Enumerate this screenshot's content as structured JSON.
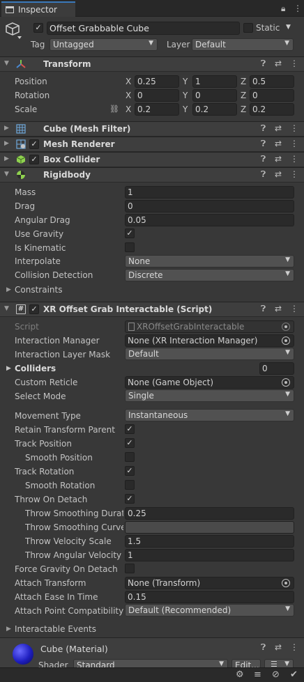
{
  "tab": {
    "label": "Inspector"
  },
  "object": {
    "name": "Offset Grabbable Cube",
    "static_label": "Static",
    "tag_label": "Tag",
    "tag_value": "Untagged",
    "layer_label": "Layer",
    "layer_value": "Default"
  },
  "transform": {
    "title": "Transform",
    "position_label": "Position",
    "rotation_label": "Rotation",
    "scale_label": "Scale",
    "x": "X",
    "y": "Y",
    "z": "Z",
    "position": [
      "0.25",
      "1",
      "0.5"
    ],
    "rotation": [
      "0",
      "0",
      "0"
    ],
    "scale": [
      "0.2",
      "0.2",
      "0.2"
    ]
  },
  "components": {
    "mesh_filter": "Cube (Mesh Filter)",
    "mesh_renderer": "Mesh Renderer",
    "box_collider": "Box Collider",
    "rigidbody": "Rigidbody"
  },
  "rigidbody": {
    "mass_label": "Mass",
    "mass": "1",
    "drag_label": "Drag",
    "drag": "0",
    "angular_drag_label": "Angular Drag",
    "angular_drag": "0.05",
    "use_gravity_label": "Use Gravity",
    "is_kinematic_label": "Is Kinematic",
    "interpolate_label": "Interpolate",
    "interpolate": "None",
    "collision_label": "Collision Detection",
    "collision": "Discrete",
    "constraints_label": "Constraints"
  },
  "xr": {
    "title": "XR Offset Grab Interactable (Script)",
    "script_label": "Script",
    "script": "XROffsetGrabInteractable",
    "interaction_manager_label": "Interaction Manager",
    "interaction_manager": "None (XR Interaction Manager)",
    "layer_mask_label": "Interaction Layer Mask",
    "layer_mask": "Default",
    "colliders_label": "Colliders",
    "colliders": "0",
    "custom_reticle_label": "Custom Reticle",
    "custom_reticle": "None (Game Object)",
    "select_mode_label": "Select Mode",
    "select_mode": "Single",
    "movement_type_label": "Movement Type",
    "movement_type": "Instantaneous",
    "retain_parent_label": "Retain Transform Parent",
    "track_position_label": "Track Position",
    "smooth_position_label": "Smooth Position",
    "track_rotation_label": "Track Rotation",
    "smooth_rotation_label": "Smooth Rotation",
    "throw_on_detach_label": "Throw On Detach",
    "throw_smoothing_duration_label": "Throw Smoothing Duratic",
    "throw_smoothing_duration": "0.25",
    "throw_smoothing_curve_label": "Throw Smoothing Curve",
    "throw_velocity_scale_label": "Throw Velocity Scale",
    "throw_velocity_scale": "1.5",
    "throw_angular_label": "Throw Angular Velocity S",
    "throw_angular": "1",
    "force_gravity_label": "Force Gravity On Detach",
    "attach_transform_label": "Attach Transform",
    "attach_transform": "None (Transform)",
    "attach_ease_label": "Attach Ease In Time",
    "attach_ease": "0.15",
    "attach_compat_label": "Attach Point Compatibility M",
    "attach_compat": "Default (Recommended)",
    "events_label": "Interactable Events"
  },
  "material": {
    "title": "Cube (Material)",
    "shader_label": "Shader",
    "shader": "Standard",
    "edit_label": "Edit..."
  },
  "colors": {
    "accent": "#3a79bb",
    "panel": "#383838",
    "header": "#3e3e3e"
  }
}
